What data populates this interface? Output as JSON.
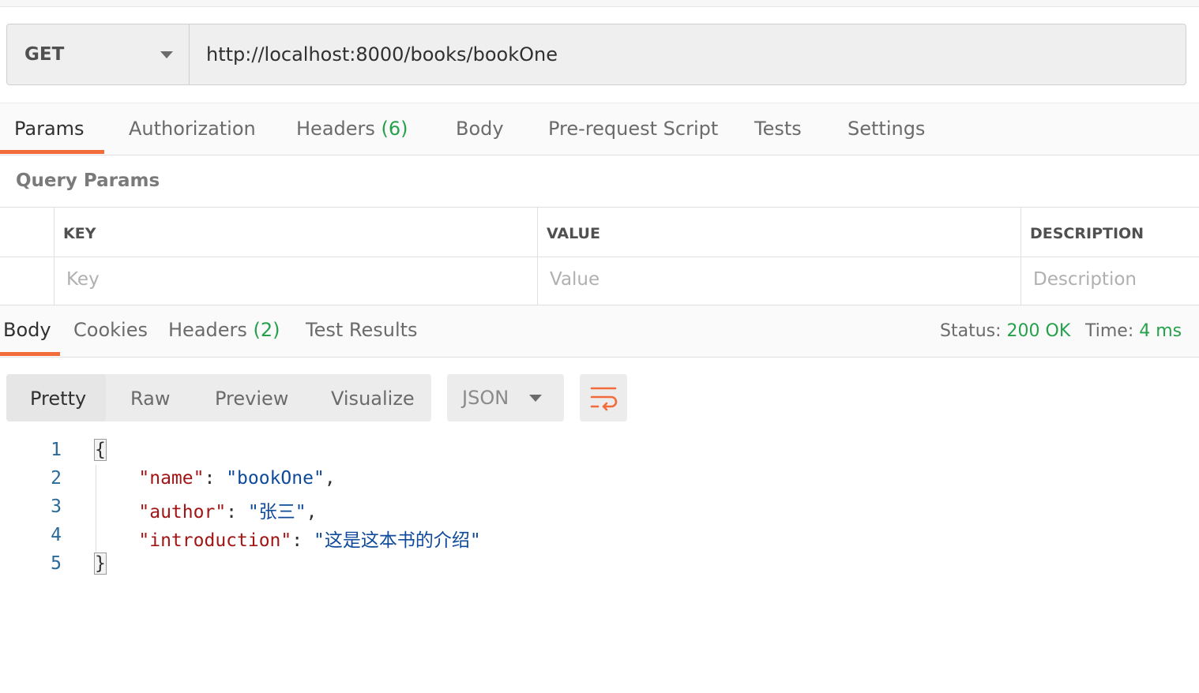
{
  "request": {
    "method": "GET",
    "url": "http://localhost:8000/books/bookOne"
  },
  "request_tabs": [
    {
      "label": "Params",
      "active": true
    },
    {
      "label": "Authorization"
    },
    {
      "label": "Headers",
      "count": "(6)"
    },
    {
      "label": "Body"
    },
    {
      "label": "Pre-request Script"
    },
    {
      "label": "Tests"
    },
    {
      "label": "Settings"
    }
  ],
  "query_params": {
    "title": "Query Params",
    "columns": [
      "KEY",
      "VALUE",
      "DESCRIPTION"
    ],
    "placeholders": [
      "Key",
      "Value",
      "Description"
    ]
  },
  "response_tabs": [
    {
      "label": "Body",
      "active": true
    },
    {
      "label": "Cookies"
    },
    {
      "label": "Headers",
      "count": "(2)"
    },
    {
      "label": "Test Results"
    }
  ],
  "status": {
    "status_label": "Status:",
    "status_value": "200 OK",
    "time_label": "Time:",
    "time_value": "4 ms"
  },
  "view_modes": [
    "Pretty",
    "Raw",
    "Preview",
    "Visualize"
  ],
  "format": "JSON",
  "icons": {
    "wrap": "wrap-lines-icon",
    "dropdown": "chevron-down-icon"
  },
  "colors": {
    "accent": "#f26b3a",
    "count": "#26a14b",
    "json_key": "#a31515",
    "json_string": "#0f4a9a"
  },
  "code": {
    "line_numbers": [
      "1",
      "2",
      "3",
      "4",
      "5"
    ],
    "open_brace": "{",
    "close_brace": "}",
    "entries": [
      {
        "key": "\"name\"",
        "value": "\"bookOne\"",
        "comma": ","
      },
      {
        "key": "\"author\"",
        "value": "\"张三\"",
        "comma": ","
      },
      {
        "key": "\"introduction\"",
        "value": "\"这是这本书的介绍\"",
        "comma": ""
      }
    ]
  }
}
